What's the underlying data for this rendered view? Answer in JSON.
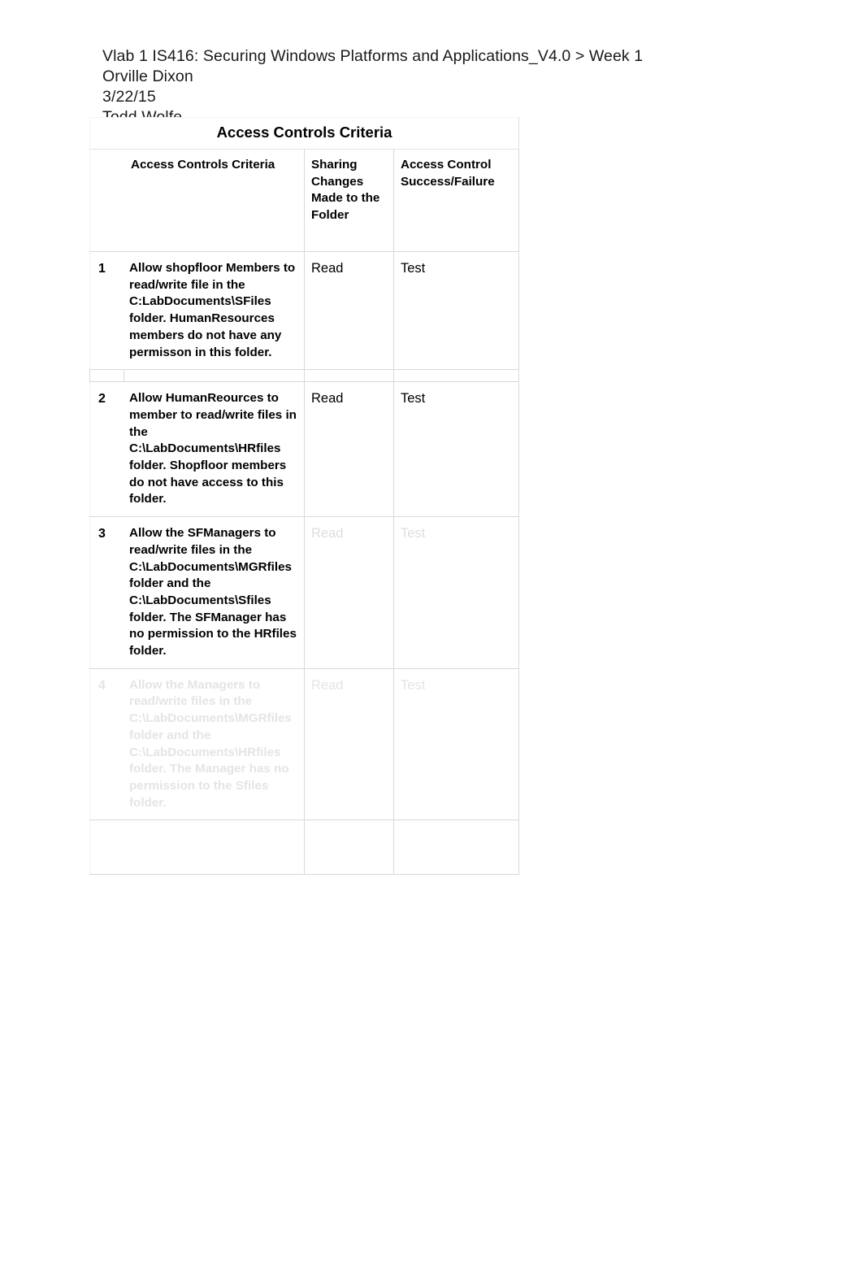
{
  "document": {
    "header_lines": [
      "Vlab 1 IS416: Securing Windows Platforms and Applications_V4.0 > Week 1",
      "Orville Dixon",
      "3/22/15",
      "Todd Wolfe"
    ]
  },
  "table": {
    "title": "Access Controls Criteria",
    "columns": [
      {
        "key": "number",
        "label": ""
      },
      {
        "key": "criteria",
        "label": "Access Controls Criteria"
      },
      {
        "key": "sharing",
        "label": "Sharing Changes Made to the Folder"
      },
      {
        "key": "result",
        "label": "Access Control Success/Failure"
      }
    ],
    "rows": [
      {
        "number": "1",
        "criteria": "Allow shopfloor Members to read/write  file  in the C:LabDocuments\\SFiles folder. HumanResources members do not have any permisson in this folder.",
        "sharing": "Read",
        "result": "Test",
        "render": "normal"
      },
      {
        "number": "2",
        "criteria": "Allow HumanReources to member to read/write files in the C:\\LabDocuments\\HRfiles folder. Shopfloor members do not have access to this folder.",
        "sharing": "Read",
        "result": "Test",
        "render": "normal"
      },
      {
        "number": "3",
        "criteria": "Allow the SFManagers to read/write files in the C:\\LabDocuments\\MGRfiles folder and the C:\\LabDocuments\\Sfiles folder. The SFManager has no permission to the HRfiles folder.",
        "sharing": "Read",
        "result": "Test",
        "render": "ghost-cells"
      },
      {
        "number": "4",
        "criteria": "Allow the Managers to read/write files in the C:\\LabDocuments\\MGRfiles folder and the C:\\LabDocuments\\HRfiles folder. The Manager has no permission to the Sfiles folder.",
        "sharing": "Read",
        "result": "Test",
        "render": "ghost-row"
      },
      {
        "number": "",
        "criteria": "",
        "sharing": "",
        "result": "",
        "render": "empty"
      }
    ]
  },
  "colors": {
    "page_background": "#ffffff",
    "text": "#000000",
    "header_text": "#1a1a1a",
    "table_border": "#d9d9d9"
  }
}
